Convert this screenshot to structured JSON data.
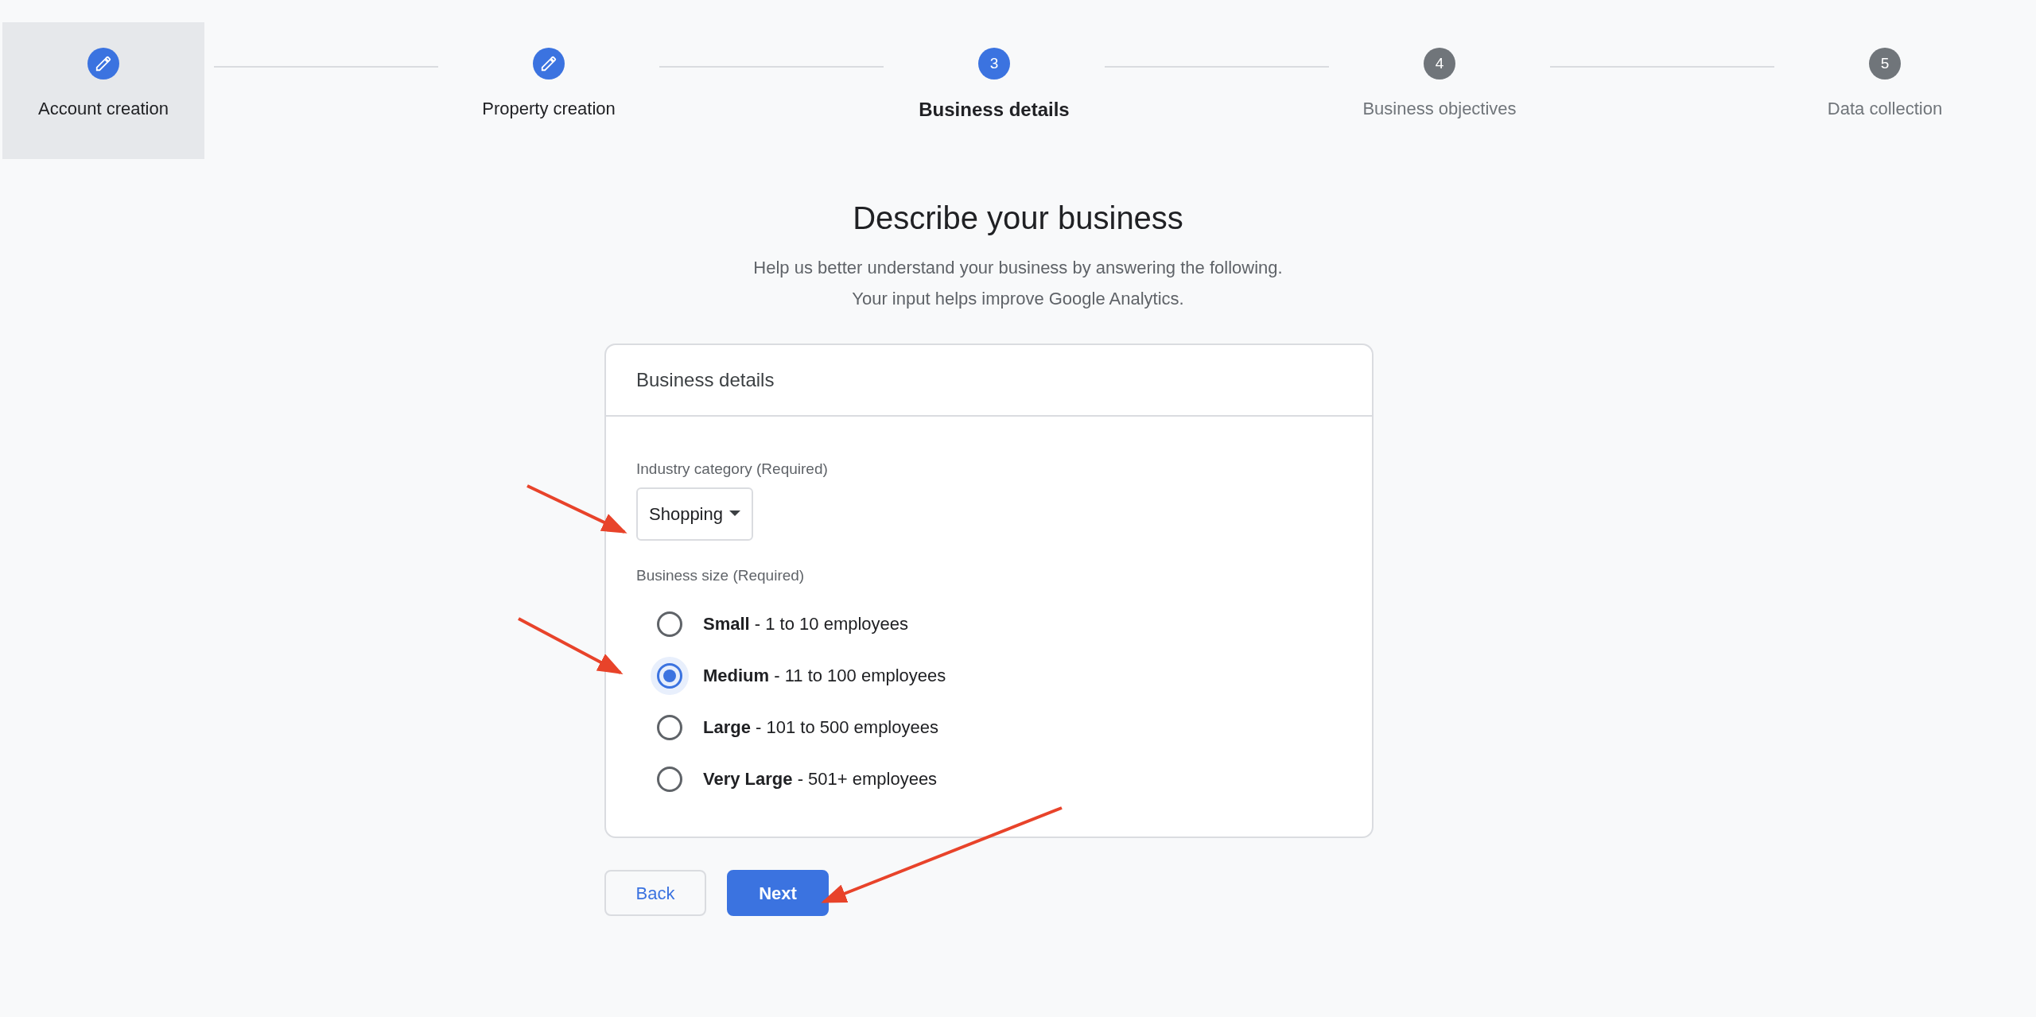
{
  "stepper": [
    {
      "label": "Account creation",
      "kind": "edit",
      "selected": false,
      "highlighted": true
    },
    {
      "label": "Property creation",
      "kind": "edit",
      "selected": false,
      "highlighted": false
    },
    {
      "label": "Business details",
      "kind": "number",
      "number": "3",
      "selected": true,
      "highlighted": false
    },
    {
      "label": "Business objectives",
      "kind": "number",
      "number": "4",
      "selected": false,
      "highlighted": false
    },
    {
      "label": "Data collection",
      "kind": "number",
      "number": "5",
      "selected": false,
      "highlighted": false
    }
  ],
  "heading": "Describe your business",
  "intro": [
    "Help us better understand your business by answering the following.",
    "Your input helps improve Google Analytics."
  ],
  "card": {
    "title": "Business details",
    "industry": {
      "label": "Industry category (Required)",
      "value": "Shopping"
    },
    "size": {
      "label": "Business size (Required)",
      "options": [
        {
          "text": "**Small** - 1 to 10 employees",
          "selected": false
        },
        {
          "text": "**Medium** - 11 to 100 employees",
          "selected": true
        },
        {
          "text": "**Large** - 101 to 500 employees",
          "selected": false
        },
        {
          "text": "**Very Large** - 501+ employees",
          "selected": false
        }
      ]
    }
  },
  "buttons": [
    {
      "label": "Back",
      "kind": "secondary"
    },
    {
      "label": "Next",
      "kind": "primary"
    }
  ]
}
